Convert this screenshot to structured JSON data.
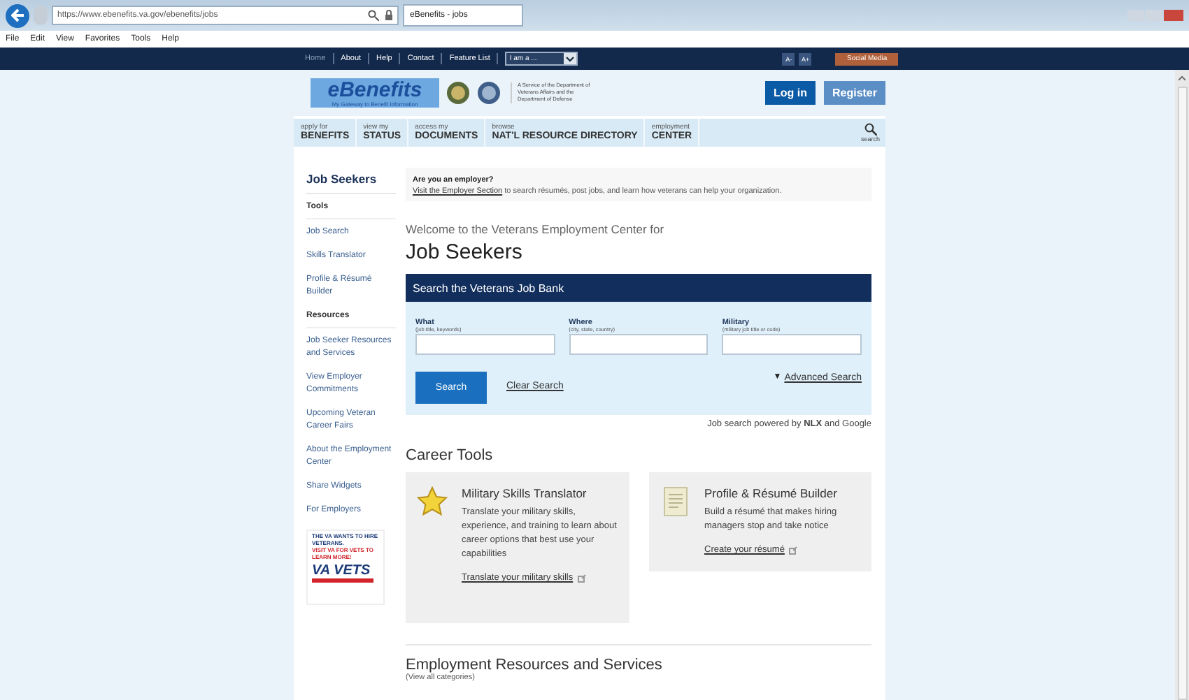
{
  "browser": {
    "address": "https://www.ebenefits.va.gov/ebenefits/jobs",
    "tab_title": "eBenefits - jobs",
    "menu": [
      "File",
      "Edit",
      "View",
      "Favorites",
      "Tools",
      "Help"
    ]
  },
  "top_nav": {
    "links": [
      {
        "label": "Home",
        "selected": true
      },
      {
        "label": "About",
        "selected": false
      },
      {
        "label": "Help",
        "selected": false
      },
      {
        "label": "Contact",
        "selected": false
      },
      {
        "label": "Feature List",
        "selected": false
      }
    ],
    "role_select": {
      "value": "I am a ..."
    },
    "font_buttons": [
      "A-",
      "A+"
    ],
    "social_button": "Social Media"
  },
  "header": {
    "logo_title": "eBenefits",
    "logo_tagline": "My Gateway to Benefit Information",
    "service_text": "A Service of the Department of Veterans Affairs and the Department of Defense",
    "buttons": [
      {
        "label": "Log in",
        "kind": "primary"
      },
      {
        "label": "Register",
        "kind": "secondary"
      }
    ]
  },
  "main_nav": {
    "items": [
      {
        "small": "apply for",
        "big": "BENEFITS"
      },
      {
        "small": "view my",
        "big": "STATUS"
      },
      {
        "small": "access my",
        "big": "DOCUMENTS"
      },
      {
        "small": "browse",
        "big": "NAT'L RESOURCE DIRECTORY"
      },
      {
        "small": "employment",
        "big": "CENTER"
      }
    ],
    "search_label": "search"
  },
  "sidebar": {
    "title": "Job Seekers",
    "sections": [
      {
        "heading": "Tools",
        "items": [
          "Job Search",
          "Skills Translator",
          "Profile & Résumé Builder"
        ]
      },
      {
        "heading": "Resources",
        "items": [
          "Job Seeker Resources and Services",
          "View Employer Commitments",
          "Upcoming Veteran Career Fairs",
          "About the Employment Center",
          "Share Widgets",
          "For Employers"
        ]
      }
    ],
    "ad": {
      "line_1": "THE VA WANTS TO HIRE VETERANS.",
      "line_2": "VISIT VA FOR VETS TO LEARN MORE!",
      "logo": "VA VETS"
    }
  },
  "employer_notice": {
    "title": "Are you an employer?",
    "link": "Visit the Employer Section",
    "text": "to search résumés, post jobs, and learn how veterans can help your organization."
  },
  "welcome": {
    "subtitle": "Welcome to the Veterans Employment Center for",
    "title": "Job Seekers"
  },
  "job_search": {
    "title": "Search the Veterans Job Bank",
    "fields": [
      {
        "label": "What",
        "hint": "(job title, keywords)"
      },
      {
        "label": "Where",
        "hint": "(city, state, country)"
      },
      {
        "label": "Military",
        "hint": "(military job title or code)"
      }
    ],
    "search_button": "Search",
    "clear_link": "Clear Search",
    "advanced_marker": "▼",
    "advanced_link": "Advanced Search",
    "powered_by": "Job search powered by **NLX** and Google"
  },
  "career_tools": {
    "title": "Career Tools",
    "cards": [
      {
        "kind": "star",
        "title": "Military Skills Translator",
        "text": "Translate your military skills, experience, and training to learn about career options that best use your capabilities",
        "link": "Translate your military skills"
      },
      {
        "kind": "document",
        "title": "Profile & Résumé Builder",
        "text": "Build a résumé that makes hiring managers stop and take notice",
        "link": "Create your résumé"
      }
    ]
  },
  "resources": {
    "title": "Employment Resources and Services",
    "link": "(View all categories)"
  }
}
